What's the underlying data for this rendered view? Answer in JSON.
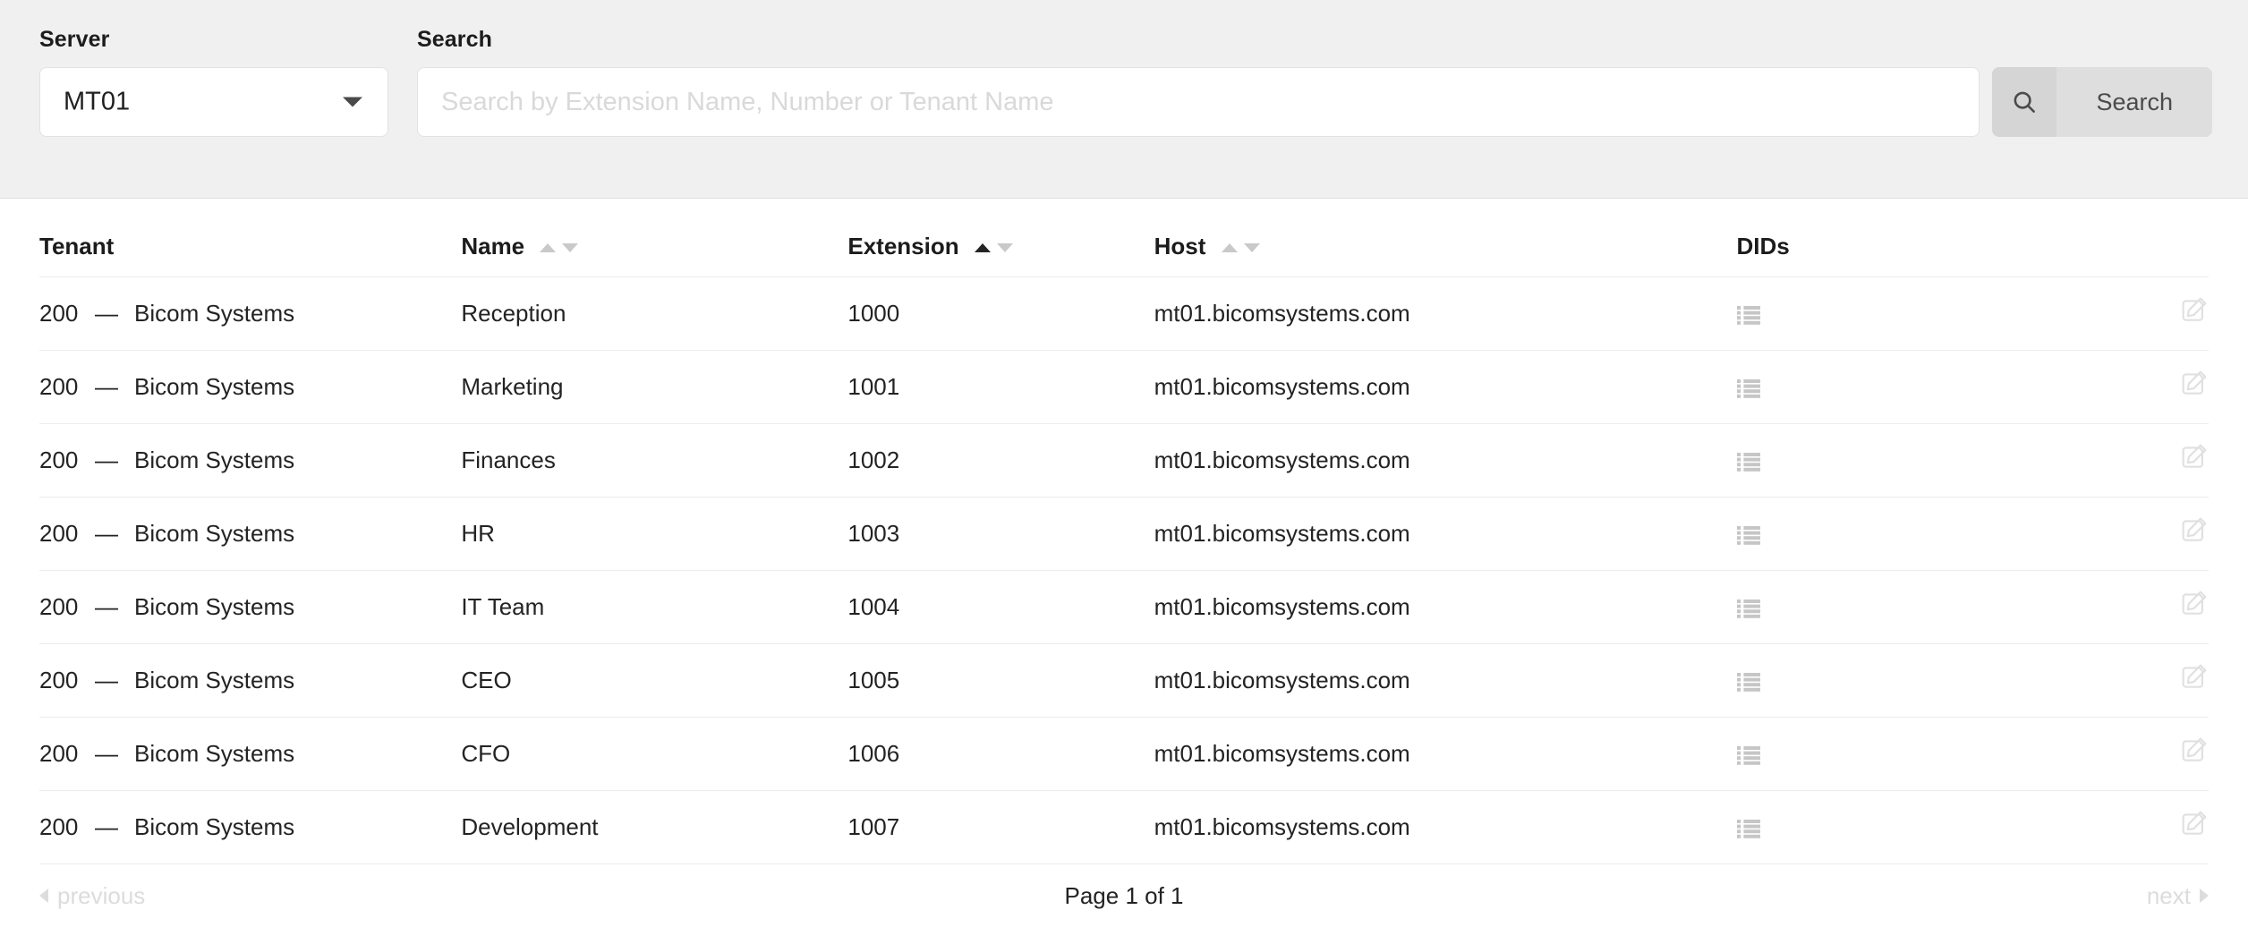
{
  "toolbar": {
    "server_label": "Server",
    "server_value": "MT01",
    "search_label": "Search",
    "search_placeholder": "Search by Extension Name, Number or Tenant Name",
    "search_value": "",
    "search_button_label": "Search",
    "search_icon": "search-icon",
    "caret_icon": "chevron-down-icon"
  },
  "table": {
    "columns": [
      {
        "key": "tenant",
        "label": "Tenant",
        "sortable": false,
        "sort": "none"
      },
      {
        "key": "name",
        "label": "Name",
        "sortable": true,
        "sort": "none"
      },
      {
        "key": "extension",
        "label": "Extension",
        "sortable": true,
        "sort": "asc"
      },
      {
        "key": "host",
        "label": "Host",
        "sortable": true,
        "sort": "none"
      },
      {
        "key": "dids",
        "label": "DIDs",
        "sortable": false,
        "sort": "none"
      }
    ],
    "rows": [
      {
        "tenant_id": "200",
        "tenant_dash": "—",
        "tenant_name": "Bicom Systems",
        "name": "Reception",
        "extension": "1000",
        "host": "mt01.bicomsystems.com",
        "dids_icon": "list-icon",
        "edit_icon": "edit-icon"
      },
      {
        "tenant_id": "200",
        "tenant_dash": "—",
        "tenant_name": "Bicom Systems",
        "name": "Marketing",
        "extension": "1001",
        "host": "mt01.bicomsystems.com",
        "dids_icon": "list-icon",
        "edit_icon": "edit-icon"
      },
      {
        "tenant_id": "200",
        "tenant_dash": "—",
        "tenant_name": "Bicom Systems",
        "name": "Finances",
        "extension": "1002",
        "host": "mt01.bicomsystems.com",
        "dids_icon": "list-icon",
        "edit_icon": "edit-icon"
      },
      {
        "tenant_id": "200",
        "tenant_dash": "—",
        "tenant_name": "Bicom Systems",
        "name": "HR",
        "extension": "1003",
        "host": "mt01.bicomsystems.com",
        "dids_icon": "list-icon",
        "edit_icon": "edit-icon"
      },
      {
        "tenant_id": "200",
        "tenant_dash": "—",
        "tenant_name": "Bicom Systems",
        "name": "IT Team",
        "extension": "1004",
        "host": "mt01.bicomsystems.com",
        "dids_icon": "list-icon",
        "edit_icon": "edit-icon"
      },
      {
        "tenant_id": "200",
        "tenant_dash": "—",
        "tenant_name": "Bicom Systems",
        "name": "CEO",
        "extension": "1005",
        "host": "mt01.bicomsystems.com",
        "dids_icon": "list-icon",
        "edit_icon": "edit-icon"
      },
      {
        "tenant_id": "200",
        "tenant_dash": "—",
        "tenant_name": "Bicom Systems",
        "name": "CFO",
        "extension": "1006",
        "host": "mt01.bicomsystems.com",
        "dids_icon": "list-icon",
        "edit_icon": "edit-icon"
      },
      {
        "tenant_id": "200",
        "tenant_dash": "—",
        "tenant_name": "Bicom Systems",
        "name": "Development",
        "extension": "1007",
        "host": "mt01.bicomsystems.com",
        "dids_icon": "list-icon",
        "edit_icon": "edit-icon"
      }
    ]
  },
  "pagination": {
    "previous_label": "previous",
    "next_label": "next",
    "page_info": "Page 1 of 1",
    "prev_icon": "triangle-left-icon",
    "next_icon": "triangle-right-icon"
  },
  "colors": {
    "toolbar_bg": "#f0f0f0",
    "page_bg": "#ffffff",
    "text": "#1c1c1c",
    "muted": "#dcdcdc",
    "icon_gray": "#c9c9c9",
    "button_bg": "#dedede",
    "row_divider": "#ececec"
  }
}
